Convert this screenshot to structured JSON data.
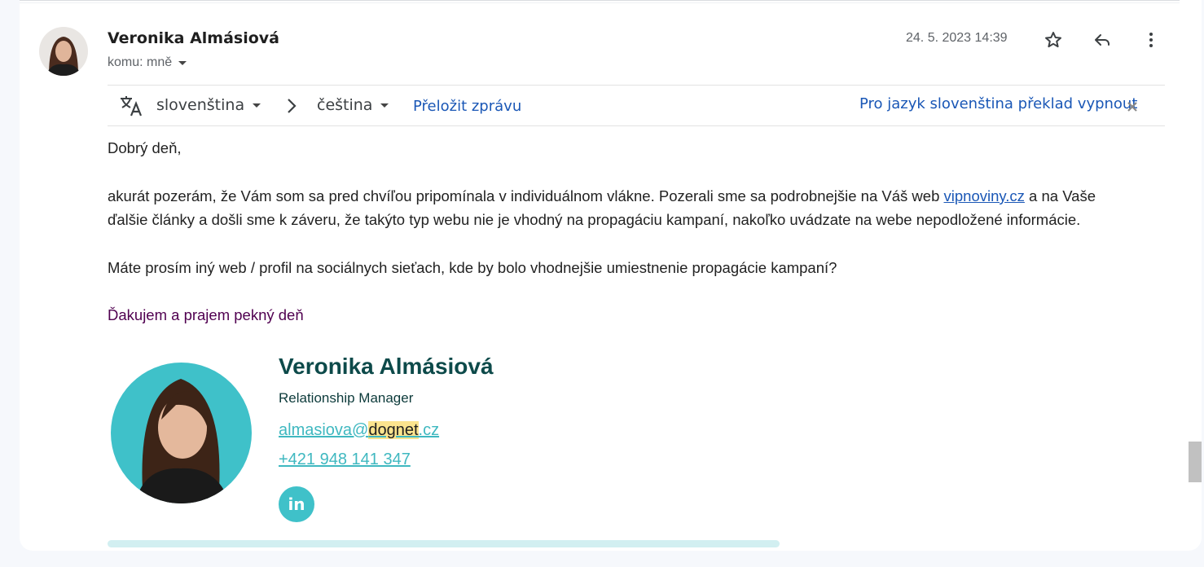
{
  "message": {
    "sender_name": "Veronika Almásiová",
    "recipient_label": "komu: mně",
    "date": "24. 5. 2023 14:39",
    "icons": [
      "avatar-photo",
      "star-icon",
      "reply-icon",
      "more-vert-icon"
    ]
  },
  "translation_bar": {
    "source_lang": "slovenština",
    "target_lang": "čeština",
    "translate_link": "Přeložit zprávu",
    "disable_link": "Pro jazyk slovenština překlad vypnout",
    "icons": [
      "translate-icon",
      "chevron-right-icon",
      "close-icon"
    ]
  },
  "body": {
    "greeting": "Dobrý deň,",
    "para1_part1": "akurát pozerám, že Vám som sa pred chvíľou pripomínala v individuálnom vlákne. Pozerali sme sa podrobnejšie na Váš web ",
    "para1_link": "vipnoviny.cz",
    "para1_part2": " a na Vaše",
    "para1_line2": "ďalšie články a došli sme k záveru, že takýto typ webu nie je vhodný na propagáciu kampaní, nakoľko uvádzate na webe nepodložené informácie.",
    "para2": "Máte prosím iný web / profil na sociálnych sieťach, kde by bolo vhodnejšie umiestnenie propagácie kampaní?",
    "closing": "Ďakujem a prajem pekný deň"
  },
  "signature": {
    "name": "Veronika Almásiová",
    "role": "Relationship Manager",
    "email_prefix": "almasiova@",
    "email_highlight": "dognet",
    "email_suffix": ".cz",
    "phone": "+421 948 141 347",
    "linkedin_label": "in",
    "accent_color": "#3fc1c9",
    "highlight_color": "#fce48e"
  }
}
